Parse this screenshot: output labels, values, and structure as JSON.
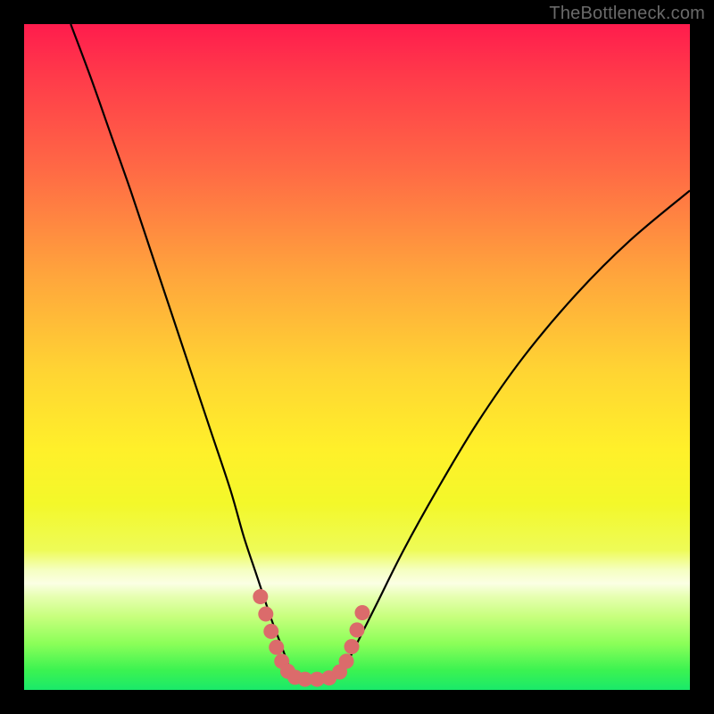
{
  "watermark": {
    "text": "TheBottleneck.com"
  },
  "chart_data": {
    "type": "line",
    "title": "",
    "xlabel": "",
    "ylabel": "",
    "xlim": [
      0,
      100
    ],
    "ylim": [
      0,
      100
    ],
    "grid": false,
    "legend": false,
    "annotations": [],
    "series": [
      {
        "name": "left-curve",
        "color": "#000000",
        "x": [
          7,
          10,
          13,
          16,
          19,
          22,
          25,
          28,
          31,
          33,
          35,
          37,
          38.5,
          40
        ],
        "y": [
          100,
          92,
          83.5,
          75,
          66,
          57,
          48,
          39,
          30,
          23,
          17,
          11,
          7,
          3
        ]
      },
      {
        "name": "right-curve",
        "color": "#000000",
        "x": [
          48,
          50,
          53,
          57,
          62,
          68,
          75,
          83,
          91,
          100
        ],
        "y": [
          3,
          7,
          13,
          21,
          30,
          40,
          50,
          59.5,
          67.5,
          75
        ]
      },
      {
        "name": "threshold-marker",
        "color": "#db6b6b",
        "x": [
          35.5,
          36.3,
          37.1,
          37.9,
          38.7,
          39.6,
          40.7,
          42.2,
          44.0,
          45.8,
          47.4,
          48.4,
          49.2,
          50.0,
          50.8
        ],
        "y": [
          14.0,
          11.4,
          8.8,
          6.4,
          4.3,
          2.8,
          1.9,
          1.6,
          1.6,
          1.8,
          2.7,
          4.3,
          6.5,
          9.0,
          11.6
        ]
      }
    ],
    "background": {
      "type": "vertical-gradient",
      "stops": [
        {
          "pos": 0.0,
          "color": "#ff1c4d"
        },
        {
          "pos": 0.38,
          "color": "#ffa63c"
        },
        {
          "pos": 0.64,
          "color": "#fff02a"
        },
        {
          "pos": 0.84,
          "color": "#fbffe4"
        },
        {
          "pos": 1.0,
          "color": "#1ae96a"
        }
      ]
    }
  }
}
